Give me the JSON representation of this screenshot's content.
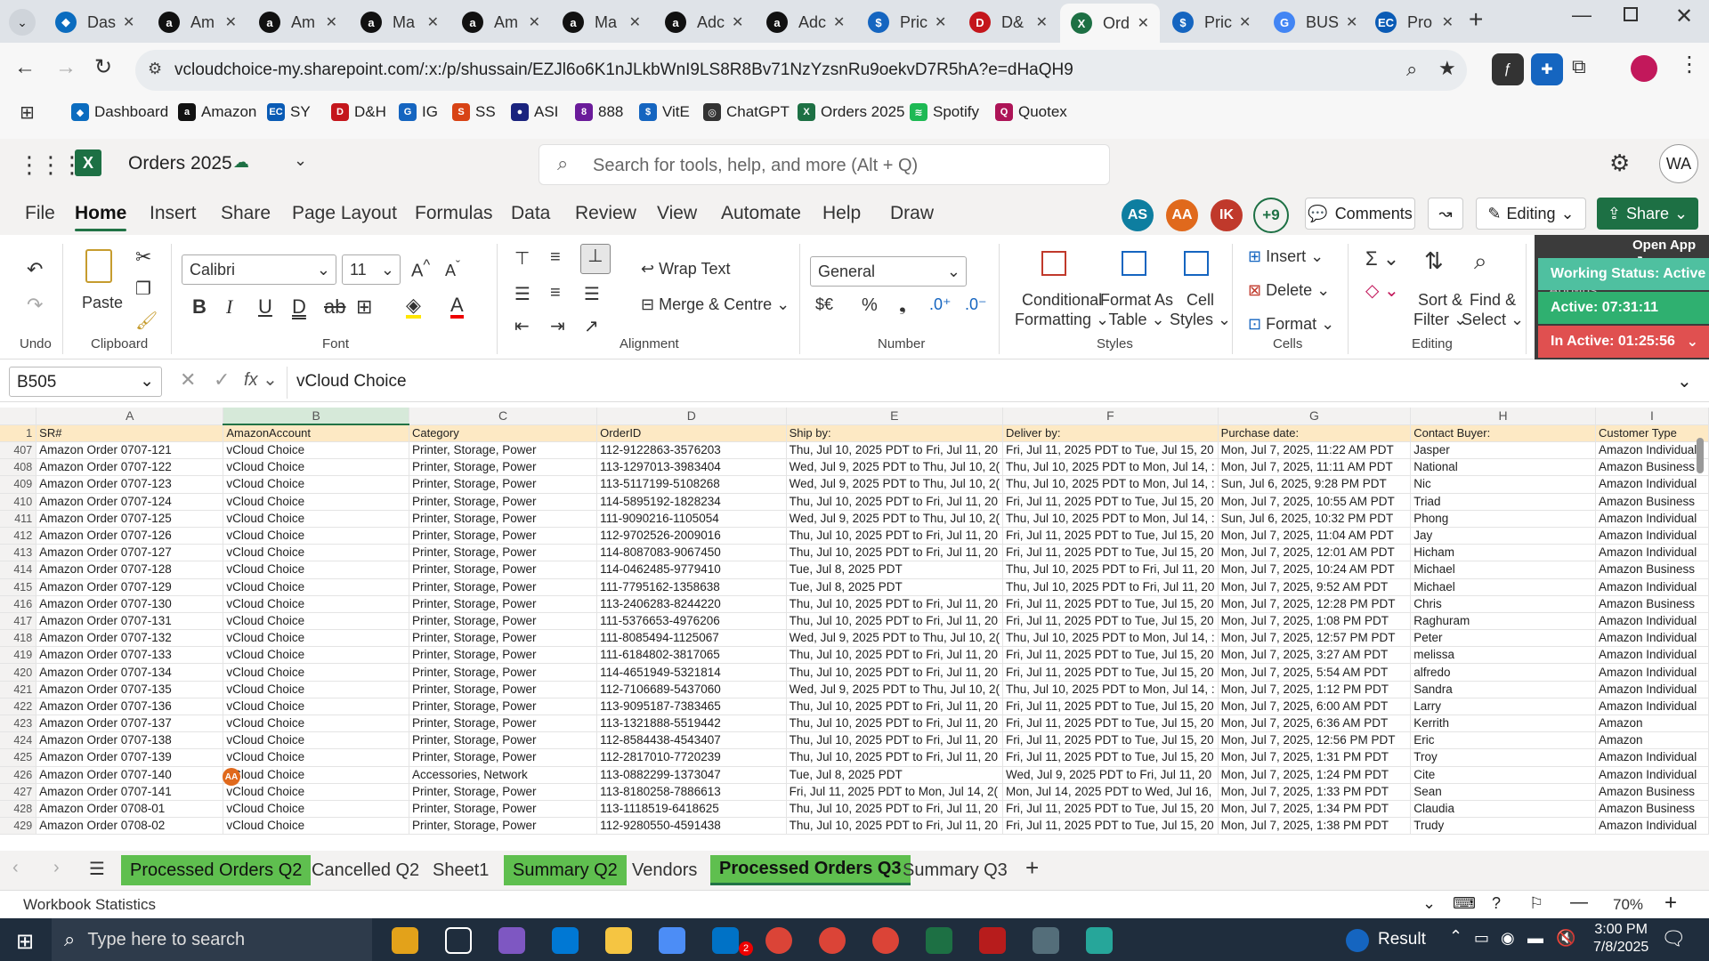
{
  "browser": {
    "tabs": [
      {
        "label": "Das",
        "icon": "dashboard-icon",
        "color": "#0b6cbf",
        "icon_text": "◆"
      },
      {
        "label": "Am",
        "icon": "amazon-icon",
        "color": "#111111",
        "icon_text": "a"
      },
      {
        "label": "Am",
        "icon": "amazon-icon",
        "color": "#111111",
        "icon_text": "a"
      },
      {
        "label": "Ma",
        "icon": "amazon-icon",
        "color": "#111111",
        "icon_text": "a"
      },
      {
        "label": "Am",
        "icon": "amazon-icon",
        "color": "#111111",
        "icon_text": "a"
      },
      {
        "label": "Ma",
        "icon": "amazon-icon",
        "color": "#111111",
        "icon_text": "a"
      },
      {
        "label": "Adc",
        "icon": "amazon-icon",
        "color": "#111111",
        "icon_text": "a"
      },
      {
        "label": "Adc",
        "icon": "amazon-icon",
        "color": "#111111",
        "icon_text": "a"
      },
      {
        "label": "Pric",
        "icon": "price-icon",
        "color": "#1565c0",
        "icon_text": "$"
      },
      {
        "label": "D&",
        "icon": "dh-icon",
        "color": "#c4161c",
        "icon_text": "D"
      },
      {
        "label": "Ord",
        "icon": "excel-icon",
        "color": "#1d7044",
        "icon_text": "X",
        "active": true
      },
      {
        "label": "Pric",
        "icon": "price-icon",
        "color": "#1565c0",
        "icon_text": "$"
      },
      {
        "label": "BUS",
        "icon": "google-icon",
        "color": "#4285f4",
        "icon_text": "G"
      },
      {
        "label": "Pro",
        "icon": "ec-icon",
        "color": "#0a5bb5",
        "icon_text": "EC"
      }
    ],
    "url": "vcloudchoice-my.sharepoint.com/:x:/p/shussain/EZJl6o6K1nJLkbWnI9LS8R8Bv71NzYzsnRu9oekvD7R5hA?e=dHaQH9",
    "bookmarks": [
      {
        "label": "Dashboard",
        "color": "#0b6cbf",
        "icon_text": "◆"
      },
      {
        "label": "Amazon",
        "color": "#111111",
        "icon_text": "a"
      },
      {
        "label": "SY",
        "color": "#0a5bb5",
        "icon_text": "EC"
      },
      {
        "label": "D&H",
        "color": "#c4161c",
        "icon_text": "D"
      },
      {
        "label": "IG",
        "color": "#1565c0",
        "icon_text": "G"
      },
      {
        "label": "SS",
        "color": "#d84315",
        "icon_text": "S"
      },
      {
        "label": "ASI",
        "color": "#1a237e",
        "icon_text": "●"
      },
      {
        "label": "888",
        "color": "#6a1b9a",
        "icon_text": "8"
      },
      {
        "label": "VitE",
        "color": "#1565c0",
        "icon_text": "$"
      },
      {
        "label": "ChatGPT",
        "color": "#333333",
        "icon_text": "◎"
      },
      {
        "label": "Orders 2025",
        "color": "#1d7044",
        "icon_text": "X"
      },
      {
        "label": "Spotify",
        "color": "#1db954",
        "icon_text": "≋"
      },
      {
        "label": "Quotex",
        "color": "#ad1457",
        "icon_text": "Q"
      }
    ]
  },
  "excel": {
    "doc_title": "Orders 2025",
    "search_placeholder": "Search for tools, help, and more (Alt + Q)",
    "user_initials": "WA",
    "menu": [
      "File",
      "Home",
      "Insert",
      "Share",
      "Page Layout",
      "Formulas",
      "Data",
      "Review",
      "View",
      "Automate",
      "Help",
      "Draw"
    ],
    "presence": [
      {
        "initials": "AS",
        "color": "#0e7ea0"
      },
      {
        "initials": "AA",
        "color": "#e0691c"
      },
      {
        "initials": "IK",
        "color": "#c0392b"
      }
    ],
    "presence_more": "+9",
    "comments_label": "Comments",
    "editing_label": "Editing",
    "share_label": "Share",
    "ribbon": {
      "undo": "Undo",
      "clipboard": "Clipboard",
      "paste": "Paste",
      "font_name": "Calibri",
      "font_size": "11",
      "font": "Font",
      "wrap_text": "Wrap Text",
      "merge": "Merge & Centre",
      "alignment": "Alignment",
      "number_format": "General",
      "number": "Number",
      "currency": "$€",
      "cond_fmt_1": "Conditional",
      "cond_fmt_2": "Formatting",
      "fmt_table_1": "Format As",
      "fmt_table_2": "Table",
      "cell_styles_1": "Cell",
      "cell_styles_2": "Styles",
      "styles": "Styles",
      "insert": "Insert",
      "delete": "Delete",
      "format": "Format",
      "cells": "Cells",
      "sort_1": "Sort &",
      "sort_2": "Filter",
      "find_1": "Find &",
      "find_2": "Select",
      "editing": "Editing",
      "open_app": "Open App",
      "addins": "Add-ins"
    },
    "work_status": {
      "status": "Working Status: Active",
      "active": "Active: 07:31:11",
      "inactive": "In Active: 01:25:56"
    },
    "name_box": "B505",
    "formula": "vCloud Choice",
    "columns": [
      "A",
      "B",
      "C",
      "D",
      "E",
      "F",
      "G",
      "H",
      "I"
    ],
    "headers": [
      "SR#",
      "AmazonAccount",
      "Category",
      "OrderID",
      "Ship by:",
      "Deliver by:",
      "Purchase date:",
      "Contact Buyer:",
      "Customer Type"
    ],
    "header_row_num": "1",
    "rows": [
      [
        "407",
        "Amazon Order 0707-121",
        "vCloud Choice",
        "Printer, Storage, Power",
        "112-9122863-3576203",
        "Thu, Jul 10, 2025 PDT to Fri, Jul 11, 20",
        "Fri, Jul 11, 2025 PDT to Tue, Jul 15, 20",
        "Mon, Jul 7, 2025, 11:22 AM PDT",
        "Jasper",
        "Amazon Individual"
      ],
      [
        "408",
        "Amazon Order 0707-122",
        "vCloud Choice",
        "Printer, Storage, Power",
        "113-1297013-3983404",
        "Wed, Jul 9, 2025 PDT to Thu, Jul 10, 2(",
        "Thu, Jul 10, 2025 PDT to Mon, Jul 14, :",
        "Mon, Jul 7, 2025, 11:11 AM PDT",
        "National",
        "Amazon Business"
      ],
      [
        "409",
        "Amazon Order 0707-123",
        "vCloud Choice",
        "Printer, Storage, Power",
        "113-5117199-5108268",
        "Wed, Jul 9, 2025 PDT to Thu, Jul 10, 2(",
        "Thu, Jul 10, 2025 PDT to Mon, Jul 14, :",
        "Sun, Jul 6, 2025, 9:28 PM PDT",
        "Nic",
        "Amazon Individual"
      ],
      [
        "410",
        "Amazon Order 0707-124",
        "vCloud Choice",
        "Printer, Storage, Power",
        "114-5895192-1828234",
        "Thu, Jul 10, 2025 PDT to Fri, Jul 11, 20",
        "Fri, Jul 11, 2025 PDT to Tue, Jul 15, 20",
        "Mon, Jul 7, 2025, 10:55 AM PDT",
        "Triad",
        "Amazon Business"
      ],
      [
        "411",
        "Amazon Order 0707-125",
        "vCloud Choice",
        "Printer, Storage, Power",
        "111-9090216-1105054",
        "Wed, Jul 9, 2025 PDT to Thu, Jul 10, 2(",
        "Thu, Jul 10, 2025 PDT to Mon, Jul 14, :",
        "Sun, Jul 6, 2025, 10:32 PM PDT",
        "Phong",
        "Amazon Individual"
      ],
      [
        "412",
        "Amazon Order 0707-126",
        "vCloud Choice",
        "Printer, Storage, Power",
        "112-9702526-2009016",
        "Thu, Jul 10, 2025 PDT to Fri, Jul 11, 20",
        "Fri, Jul 11, 2025 PDT to Tue, Jul 15, 20",
        "Mon, Jul 7, 2025, 11:04 AM PDT",
        "Jay",
        "Amazon Individual"
      ],
      [
        "413",
        "Amazon Order 0707-127",
        "vCloud Choice",
        "Printer, Storage, Power",
        "114-8087083-9067450",
        "Thu, Jul 10, 2025 PDT to Fri, Jul 11, 20",
        "Fri, Jul 11, 2025 PDT to Tue, Jul 15, 20",
        "Mon, Jul 7, 2025, 12:01 AM PDT",
        "Hicham",
        "Amazon Individual"
      ],
      [
        "414",
        "Amazon Order 0707-128",
        "vCloud Choice",
        "Printer, Storage, Power",
        "114-0462485-9779410",
        "Tue, Jul 8, 2025 PDT",
        "Thu, Jul 10, 2025 PDT to Fri, Jul 11, 20",
        "Mon, Jul 7, 2025, 10:24 AM PDT",
        "Michael",
        "Amazon Business"
      ],
      [
        "415",
        "Amazon Order 0707-129",
        "vCloud Choice",
        "Printer, Storage, Power",
        "111-7795162-1358638",
        "Tue, Jul 8, 2025 PDT",
        "Thu, Jul 10, 2025 PDT to Fri, Jul 11, 20",
        "Mon, Jul 7, 2025, 9:52 AM PDT",
        "Michael",
        "Amazon Individual"
      ],
      [
        "416",
        "Amazon Order 0707-130",
        "vCloud Choice",
        "Printer, Storage, Power",
        "113-2406283-8244220",
        "Thu, Jul 10, 2025 PDT to Fri, Jul 11, 20",
        "Fri, Jul 11, 2025 PDT to Tue, Jul 15, 20",
        "Mon, Jul 7, 2025, 12:28 PM PDT",
        "Chris",
        "Amazon Business"
      ],
      [
        "417",
        "Amazon Order 0707-131",
        "vCloud Choice",
        "Printer, Storage, Power",
        "111-5376653-4976206",
        "Thu, Jul 10, 2025 PDT to Fri, Jul 11, 20",
        "Fri, Jul 11, 2025 PDT to Tue, Jul 15, 20",
        "Mon, Jul 7, 2025, 1:08 PM PDT",
        "Raghuram",
        "Amazon Individual"
      ],
      [
        "418",
        "Amazon Order 0707-132",
        "vCloud Choice",
        "Printer, Storage, Power",
        "111-8085494-1125067",
        "Wed, Jul 9, 2025 PDT to Thu, Jul 10, 2(",
        "Thu, Jul 10, 2025 PDT to Mon, Jul 14, :",
        "Mon, Jul 7, 2025, 12:57 PM PDT",
        "Peter",
        "Amazon Individual"
      ],
      [
        "419",
        "Amazon Order 0707-133",
        "vCloud Choice",
        "Printer, Storage, Power",
        "111-6184802-3817065",
        "Thu, Jul 10, 2025 PDT to Fri, Jul 11, 20",
        "Fri, Jul 11, 2025 PDT to Tue, Jul 15, 20",
        "Mon, Jul 7, 2025, 3:27 AM PDT",
        "melissa",
        "Amazon Individual"
      ],
      [
        "420",
        "Amazon Order 0707-134",
        "vCloud Choice",
        "Printer, Storage, Power",
        "114-4651949-5321814",
        "Thu, Jul 10, 2025 PDT to Fri, Jul 11, 20",
        "Fri, Jul 11, 2025 PDT to Tue, Jul 15, 20",
        "Mon, Jul 7, 2025, 5:54 AM PDT",
        "alfredo",
        "Amazon Individual"
      ],
      [
        "421",
        "Amazon Order 0707-135",
        "vCloud Choice",
        "Printer, Storage, Power",
        "112-7106689-5437060",
        "Wed, Jul 9, 2025 PDT to Thu, Jul 10, 2(",
        "Thu, Jul 10, 2025 PDT to Mon, Jul 14, :",
        "Mon, Jul 7, 2025, 1:12 PM PDT",
        "Sandra",
        "Amazon Individual"
      ],
      [
        "422",
        "Amazon Order 0707-136",
        "vCloud Choice",
        "Printer, Storage, Power",
        "113-9095187-7383465",
        "Thu, Jul 10, 2025 PDT to Fri, Jul 11, 20",
        "Fri, Jul 11, 2025 PDT to Tue, Jul 15, 20",
        "Mon, Jul 7, 2025, 6:00 AM PDT",
        "Larry",
        "Amazon Individual"
      ],
      [
        "423",
        "Amazon Order 0707-137",
        "vCloud Choice",
        "Printer, Storage, Power",
        "113-1321888-5519442",
        "Thu, Jul 10, 2025 PDT to Fri, Jul 11, 20",
        "Fri, Jul 11, 2025 PDT to Tue, Jul 15, 20",
        "Mon, Jul 7, 2025, 6:36 AM PDT",
        "Kerrith",
        "Amazon"
      ],
      [
        "424",
        "Amazon Order 0707-138",
        "vCloud Choice",
        "Printer, Storage, Power",
        "112-8584438-4543407",
        "Thu, Jul 10, 2025 PDT to Fri, Jul 11, 20",
        "Fri, Jul 11, 2025 PDT to Tue, Jul 15, 20",
        "Mon, Jul 7, 2025, 12:56 PM PDT",
        "Eric",
        "Amazon"
      ],
      [
        "425",
        "Amazon Order 0707-139",
        "vCloud Choice",
        "Printer, Storage, Power",
        "112-2817010-7720239",
        "Thu, Jul 10, 2025 PDT to Fri, Jul 11, 20",
        "Fri, Jul 11, 2025 PDT to Tue, Jul 15, 20",
        "Mon, Jul 7, 2025, 1:31 PM PDT",
        "Troy",
        "Amazon Individual"
      ],
      [
        "426",
        "Amazon Order 0707-140",
        "vCloud Choice",
        "Accessories, Network",
        "113-0882299-1373047",
        "Tue, Jul 8, 2025 PDT",
        "Wed, Jul 9, 2025 PDT to Fri, Jul 11, 20",
        "Mon, Jul 7, 2025, 1:24 PM PDT",
        "Cite",
        "Amazon Individual"
      ],
      [
        "427",
        "Amazon Order 0707-141",
        "vCloud Choice",
        "Printer, Storage, Power",
        "113-8180258-7886613",
        "Fri, Jul 11, 2025 PDT to Mon, Jul 14, 2(",
        "Mon, Jul 14, 2025 PDT to Wed, Jul 16,",
        "Mon, Jul 7, 2025, 1:33 PM PDT",
        "Sean",
        "Amazon Business"
      ],
      [
        "428",
        "Amazon Order 0708-01",
        "vCloud Choice",
        "Printer, Storage, Power",
        "113-1118519-6418625",
        "Thu, Jul 10, 2025 PDT to Fri, Jul 11, 20",
        "Fri, Jul 11, 2025 PDT to Tue, Jul 15, 20",
        "Mon, Jul 7, 2025, 1:34 PM PDT",
        "Claudia",
        "Amazon Business"
      ],
      [
        "429",
        "Amazon Order 0708-02",
        "vCloud Choice",
        "Printer, Storage, Power",
        "112-9280550-4591438",
        "Thu, Jul 10, 2025 PDT to Fri, Jul 11, 20",
        "Fri, Jul 11, 2025 PDT to Tue, Jul 15, 20",
        "Mon, Jul 7, 2025, 1:38 PM PDT",
        "Trudy",
        "Amazon Individual"
      ]
    ],
    "comment_badge": "AA",
    "sheet_tabs": [
      {
        "label": "Processed Orders Q2",
        "green": true
      },
      {
        "label": "Cancelled Q2",
        "green": false
      },
      {
        "label": "Sheet1",
        "green": false
      },
      {
        "label": "Summary Q2",
        "green": true
      },
      {
        "label": "Vendors",
        "green": false
      },
      {
        "label": "Processed Orders Q3",
        "green": true,
        "active": true
      },
      {
        "label": "Summary Q3",
        "green": false
      }
    ],
    "status_left": "Workbook Statistics",
    "zoom": "70%"
  },
  "taskbar": {
    "search_placeholder": "Type here to search",
    "weather": "Result",
    "time": "3:00 PM",
    "date": "7/8/2025",
    "outlook_badge": "2"
  }
}
